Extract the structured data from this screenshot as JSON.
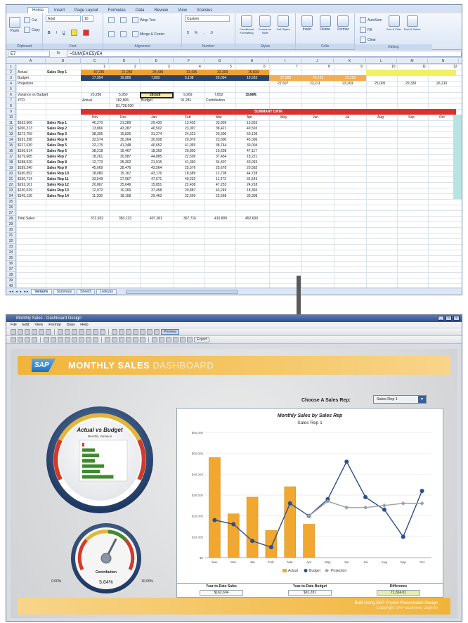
{
  "excel": {
    "ribbon_tabs": [
      "Home",
      "Insert",
      "Page Layout",
      "Formulas",
      "Data",
      "Review",
      "View",
      "Xcelsius"
    ],
    "active_tab": "Home",
    "clipboard": {
      "cut": "Cut",
      "copy": "Copy",
      "format_painter": "Format Painter",
      "paste": "Paste",
      "group": "Clipboard"
    },
    "font": {
      "name": "Arial",
      "size": "10",
      "group": "Font"
    },
    "alignment": {
      "wrap": "Wrap Text",
      "merge": "Merge & Center",
      "group": "Alignment"
    },
    "number": {
      "format": "Custom",
      "group": "Number"
    },
    "styles": {
      "conditional": "Conditional Formatting",
      "format_table": "Format as Table",
      "cell_styles": "Cell Styles",
      "group": "Styles"
    },
    "cells": {
      "insert": "Insert",
      "delete": "Delete",
      "format": "Format",
      "group": "Cells"
    },
    "editing": {
      "autosum": "AutoSum",
      "fill": "Fill",
      "clear": "Clear",
      "sort": "Sort & Filter",
      "find": "Find & Select",
      "group": "Editing"
    },
    "name_box": "E7",
    "formula": "=SUM(E4:E5)/E4",
    "columns": [
      "A",
      "B",
      "C",
      "D",
      "E",
      "F",
      "G",
      "H",
      "I",
      "J",
      "K",
      "L",
      "M",
      "N"
    ],
    "month_numbers": [
      "1",
      "2",
      "3",
      "4",
      "5",
      "6",
      "7",
      "8",
      "9",
      "10",
      "11",
      "12"
    ],
    "labels": {
      "actual": "Actual",
      "budget": "Budget",
      "projection": "Projection",
      "variance": "Variance vs Budget",
      "ytd": "YTD",
      "rep_row": "Sales Rep 1",
      "summary": "SUMMARY DATA",
      "total": "Total Sales",
      "selected_cell": "28,628",
      "under": "$1,728,000",
      "distribution": "Contribution",
      "budget_lbl": "Budget",
      "actual_lbl": "Actual",
      "ytd_budget": "182,806",
      "ytd_sales": "91,281"
    },
    "actual_row": [
      "40,235",
      "21,288",
      "28,430",
      "13,435",
      "33,309",
      "15,833"
    ],
    "budget_row": [
      "17,954",
      "16,889",
      "7,802",
      "5,108",
      "26,094",
      "19,932",
      "27,885",
      "46,129",
      "23,203",
      "22,790",
      "9,970",
      "32,080"
    ],
    "projection_row": [
      "22,507",
      "23,211",
      "23,203",
      "25,005",
      "25,330",
      "26,210"
    ],
    "variance_row": [
      "20,286",
      "5,950",
      "28,628",
      "9,269",
      "7,852",
      "12,626"
    ],
    "pct_row": "5.64%",
    "months": [
      "Nov",
      "Dec",
      "Jan",
      "Feb",
      "Mar",
      "Apr",
      "May",
      "Jun",
      "Jul",
      "Aug",
      "Sep",
      "Oct"
    ],
    "reps": [
      {
        "ytd": "$162,606",
        "name": "Sales Rep 1",
        "v": [
          "40,270",
          "21,289",
          "29,430",
          "13,435",
          "33,909",
          "15,833"
        ]
      },
      {
        "ytd": "$200,213",
        "name": "Sales Rep 2",
        "v": [
          "13,866",
          "43,287",
          "40,502",
          "23,097",
          "38,421",
          "40,593"
        ]
      },
      {
        "ytd": "$172,759",
        "name": "Sales Rep 3",
        "v": [
          "38,305",
          "15,826",
          "31,274",
          "24,623",
          "20,300",
          "50,109"
        ]
      },
      {
        "ytd": "$191,398",
        "name": "Sales Rep 4",
        "v": [
          "32,574",
          "30,264",
          "30,928",
          "20,976",
          "23,600",
          "45,006"
        ]
      },
      {
        "ytd": "$217,630",
        "name": "Sales Rep 5",
        "v": [
          "22,175",
          "41,348",
          "40,652",
          "41,093",
          "38,744",
          "30,004"
        ]
      },
      {
        "ytd": "$156,614",
        "name": "Sales Rep 6",
        "v": [
          "38,218",
          "16,467",
          "18,392",
          "20,802",
          "19,238",
          "47,117"
        ]
      },
      {
        "ytd": "$179,685",
        "name": "Sales Rep 7",
        "v": [
          "18,261",
          "30,587",
          "44,885",
          "22,509",
          "37,454",
          "18,221"
        ]
      },
      {
        "ytd": "$188,520",
        "name": "Sales Rep 8",
        "v": [
          "12,773",
          "35,302",
          "21,915",
          "41,350",
          "34,407",
          "40,033"
        ]
      },
      {
        "ytd": "$189,240",
        "name": "Sales Rep 9",
        "v": [
          "45,669",
          "28,476",
          "43,564",
          "25,576",
          "25,678",
          "20,582"
        ]
      },
      {
        "ytd": "$160,052",
        "name": "Sales Rep 10",
        "v": [
          "18,080",
          "15,167",
          "43,176",
          "18,689",
          "12,708",
          "44,728"
        ]
      },
      {
        "ytd": "$150,714",
        "name": "Sales Rep 11",
        "v": [
          "33,549",
          "27,967",
          "47,671",
          "40,232",
          "11,372",
          "31,543"
        ]
      },
      {
        "ytd": "$192,101",
        "name": "Sales Rep 12",
        "v": [
          "20,867",
          "25,649",
          "15,851",
          "22,438",
          "47,253",
          "24,218"
        ]
      },
      {
        "ytd": "$130,029",
        "name": "Sales Rep 13",
        "v": [
          "12,972",
          "10,266",
          "37,458",
          "20,887",
          "43,249",
          "18,365"
        ]
      },
      {
        "ytd": "$145,136",
        "name": "Sales Rep 14",
        "v": [
          "11,208",
          "18,158",
          "29,463",
          "32,609",
          "23,568",
          "30,308"
        ]
      }
    ],
    "totals": [
      "372,932",
      "350,123",
      "407,001",
      "367,716",
      "410,809",
      "452,600"
    ],
    "sheet_tabs": [
      "Variants",
      "Summary",
      "Sheet3",
      "Lookups"
    ],
    "active_sheet": "Variants"
  },
  "dashboard": {
    "window_title": "Monthly Sales - Dashboard Design",
    "menu": [
      "File",
      "Edit",
      "View",
      "Format",
      "Data",
      "Help"
    ],
    "toolbar_buttons": [
      "Preview",
      "Export"
    ],
    "logo": "SAP",
    "title_bold": "MONTHLY SALES",
    "title_light": "DASHBOARD",
    "choose_label": "Choose A Sales Rep:",
    "selected_rep": "Sales Rep 1",
    "gauge_title": "Actual vs Budget",
    "gauge_subtitle": "Monthly Variation",
    "small_gauge_label": "Contribution",
    "small_gauge_value": "5.64%",
    "small_gauge_min": "0.00%",
    "small_gauge_max": "10.00%",
    "footer_line1": "Built Using SAP Crystal Presentation Design",
    "footer_line2": "Copyright SAP Business Objects",
    "stats": [
      {
        "label": "Year-to-Date Sales",
        "value": "$162,604",
        "kind": "normal"
      },
      {
        "label": "Year-to-Date Budget",
        "value": "$91,281",
        "kind": "normal"
      },
      {
        "label": "Difference",
        "value": "71,324.01",
        "kind": "diff"
      }
    ],
    "colors": {
      "accent": "#f1b43a",
      "bar": "#f0a830",
      "budget": "#2d4f8a",
      "projection": "#9aa0a8",
      "hbar": "#3f8a2f"
    }
  },
  "hbars": {
    "values": [
      0.05,
      0.3,
      0.4,
      0.3,
      0.52,
      0.42,
      0.74
    ],
    "colors": [
      "#d23a2a",
      "#3f8a2f",
      "#3f8a2f",
      "#3f8a2f",
      "#3f8a2f",
      "#3f8a2f",
      "#3f8a2f"
    ]
  },
  "gauge_small_fraction": 0.6,
  "chart_data": {
    "type": "bar",
    "title": "Monthly Sales by Sales Rep",
    "subtitle": "Sales Rep 1",
    "categories": [
      "Nov",
      "Dec",
      "Jan",
      "Feb",
      "Mar",
      "Apr",
      "May",
      "Jun",
      "Jul",
      "Aug",
      "Sep",
      "Oct"
    ],
    "y_ticks": [
      "$0",
      "$10,000",
      "$20,000",
      "$30,000",
      "$40,000",
      "$50,000",
      "$60,000"
    ],
    "ylim": [
      0,
      60000
    ],
    "series": [
      {
        "name": "Actual",
        "kind": "bar",
        "values": [
          48000,
          21000,
          29000,
          13000,
          34000,
          16000,
          null,
          null,
          null,
          null,
          null,
          null
        ]
      },
      {
        "name": "Budget",
        "kind": "line",
        "values": [
          18000,
          16000,
          8000,
          5000,
          26000,
          20000,
          28000,
          46000,
          29000,
          23000,
          10000,
          32000
        ]
      },
      {
        "name": "Projection",
        "kind": "line",
        "values": [
          null,
          null,
          null,
          null,
          null,
          20000,
          27000,
          24000,
          24000,
          25000,
          26000,
          26000
        ]
      }
    ],
    "legend": [
      "Actual",
      "Budget",
      "Projection"
    ],
    "legend_position": "bottom"
  }
}
